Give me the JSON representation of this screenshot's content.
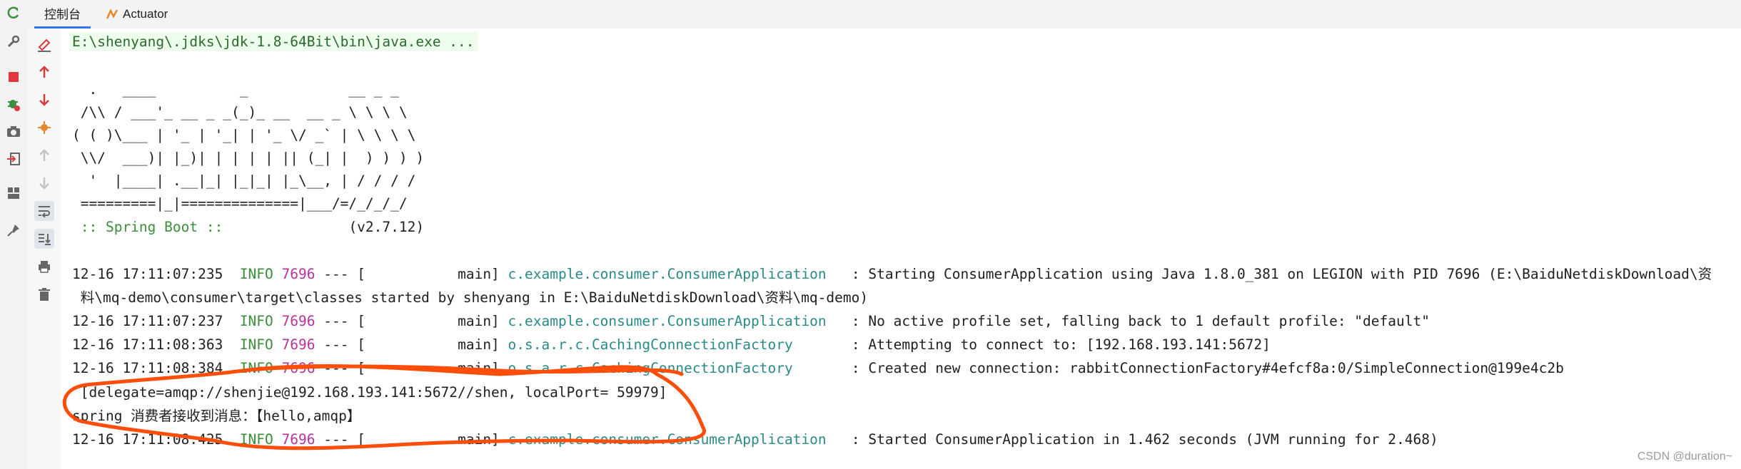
{
  "tabs": [
    {
      "label": "控制台"
    },
    {
      "label": "Actuator"
    }
  ],
  "console": {
    "command": "E:\\shenyang\\.jdks\\jdk-1.8-64Bit\\bin\\java.exe ...",
    "banner": [
      "  .   ____          _            __ _ _",
      " /\\\\ / ___'_ __ _ _(_)_ __  __ _ \\ \\ \\ \\",
      "( ( )\\___ | '_ | '_| | '_ \\/ _` | \\ \\ \\ \\",
      " \\\\/  ___)| |_)| | | | | || (_| |  ) ) ) )",
      "  '  |____| .__|_| |_|_| |_\\__, | / / / /",
      " =========|_|==============|___/=/_/_/_/"
    ],
    "spring_boot_label": " :: Spring Boot ::",
    "spring_boot_version": "(v2.7.12)",
    "logs": [
      {
        "ts": "12-16 17:11:07:235",
        "level": "INFO",
        "pid": "7696",
        "sep": "--- [",
        "thread": "main]",
        "logger": "c.example.consumer.ConsumerApplication",
        "msg": ": Starting ConsumerApplication using Java 1.8.0_381 on LEGION with PID 7696 (E:\\BaiduNetdiskDownload\\资"
      },
      {
        "cont": " 料\\mq-demo\\consumer\\target\\classes started by shenyang in E:\\BaiduNetdiskDownload\\资料\\mq-demo)"
      },
      {
        "ts": "12-16 17:11:07:237",
        "level": "INFO",
        "pid": "7696",
        "sep": "--- [",
        "thread": "main]",
        "logger": "c.example.consumer.ConsumerApplication",
        "msg": ": No active profile set, falling back to 1 default profile: \"default\""
      },
      {
        "ts": "12-16 17:11:08:363",
        "level": "INFO",
        "pid": "7696",
        "sep": "--- [",
        "thread": "main]",
        "logger": "o.s.a.r.c.CachingConnectionFactory",
        "msg": ": Attempting to connect to: [192.168.193.141:5672]"
      },
      {
        "ts": "12-16 17:11:08:384",
        "level": "INFO",
        "pid": "7696",
        "sep": "--- [",
        "thread": "main]",
        "logger": "o.s.a.r.c.CachingConnectionFactory",
        "msg": ": Created new connection: rabbitConnectionFactory#4efcf8a:0/SimpleConnection@199e4c2b"
      },
      {
        "cont": " [delegate=amqp://shenjie@192.168.193.141:5672//shen, localPort= 59979]"
      },
      {
        "cont": "spring 消费者接收到消息：【hello,amqp】"
      },
      {
        "ts": "12-16 17:11:08:425",
        "level": "INFO",
        "pid": "7696",
        "sep": "--- [",
        "thread": "main]",
        "logger": "c.example.consumer.ConsumerApplication",
        "msg": ": Started ConsumerApplication in 1.462 seconds (JVM running for 2.468)"
      }
    ]
  },
  "annotation": {
    "color": "#ff4d0a"
  },
  "watermark": "CSDN @duration~",
  "colors": {
    "info": "#3a8f3a",
    "pid": "#b8339e",
    "logger": "#2a8a86",
    "accent": "#3574f0"
  }
}
